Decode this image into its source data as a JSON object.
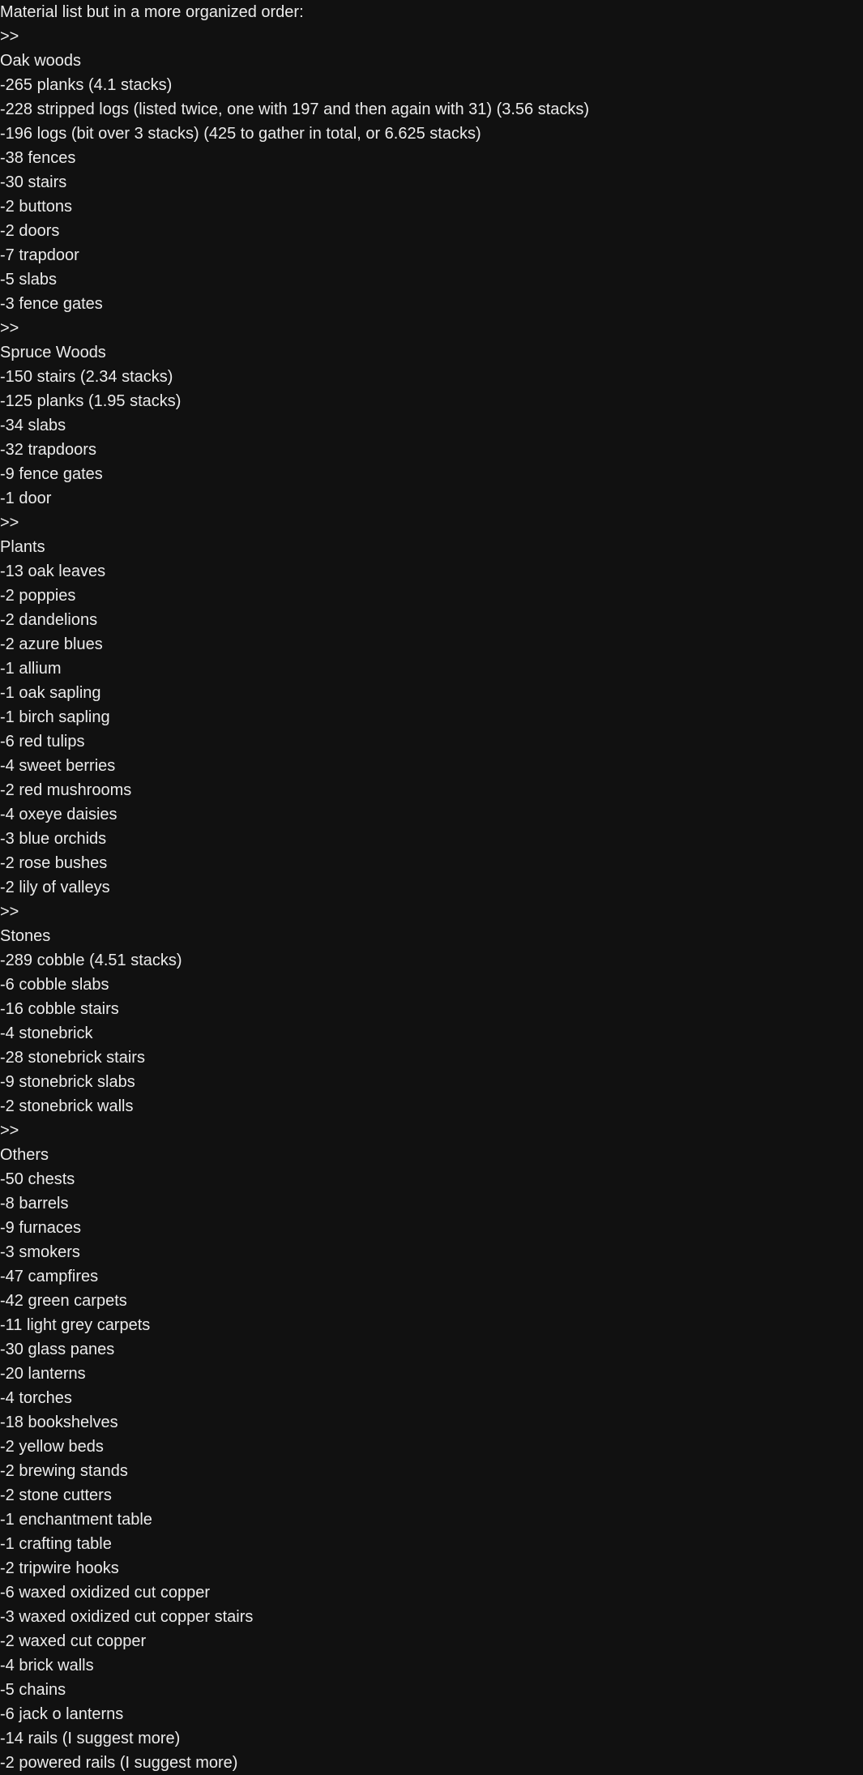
{
  "lines": [
    "Material list but in a more organized order:",
    ">>",
    "Oak woods",
    "-265 planks (4.1 stacks)",
    "-228 stripped logs (listed twice, one with 197 and then again with 31) (3.56 stacks)",
    "-196 logs (bit over 3 stacks) (425 to gather in total, or 6.625 stacks)",
    "-38 fences",
    "-30 stairs",
    "-2 buttons",
    "-2 doors",
    "-7 trapdoor",
    "-5 slabs",
    "-3 fence gates",
    ">>",
    "Spruce Woods",
    "-150 stairs (2.34 stacks)",
    "-125 planks (1.95 stacks)",
    "-34 slabs",
    "-32 trapdoors",
    "-9 fence gates",
    "-1 door",
    ">>",
    "Plants",
    "-13 oak leaves",
    "-2 poppies",
    "-2 dandelions",
    "-2 azure blues",
    "-1 allium",
    "-1 oak sapling",
    "-1 birch sapling",
    "-6 red tulips",
    "-4 sweet berries",
    "-2 red mushrooms",
    "-4 oxeye daisies",
    "-3 blue orchids",
    "-2 rose bushes",
    "-2 lily of valleys",
    ">>",
    "Stones",
    "-289 cobble (4.51 stacks)",
    "-6 cobble slabs",
    "-16 cobble stairs",
    "-4 stonebrick",
    "-28 stonebrick stairs",
    "-9 stonebrick slabs",
    "-2 stonebrick walls",
    ">>",
    "Others",
    "-50 chests",
    "-8 barrels",
    "-9 furnaces",
    "-3 smokers",
    "-47 campfires",
    "-42 green carpets",
    "-11 light grey carpets",
    "-30 glass panes",
    "-20 lanterns",
    "-4 torches",
    "-18 bookshelves",
    "-2 yellow beds",
    "-2 brewing stands",
    "-2 stone cutters",
    "-1 enchantment table",
    "-1 crafting table",
    "-2 tripwire hooks",
    "-6 waxed oxidized cut copper",
    "-3 waxed oxidized cut copper stairs",
    "-2 waxed cut copper",
    "-4 brick walls",
    "-5 chains",
    "-6 jack o lanterns",
    "-14 rails (I suggest more)",
    "-2 powered rails (I suggest more)"
  ]
}
